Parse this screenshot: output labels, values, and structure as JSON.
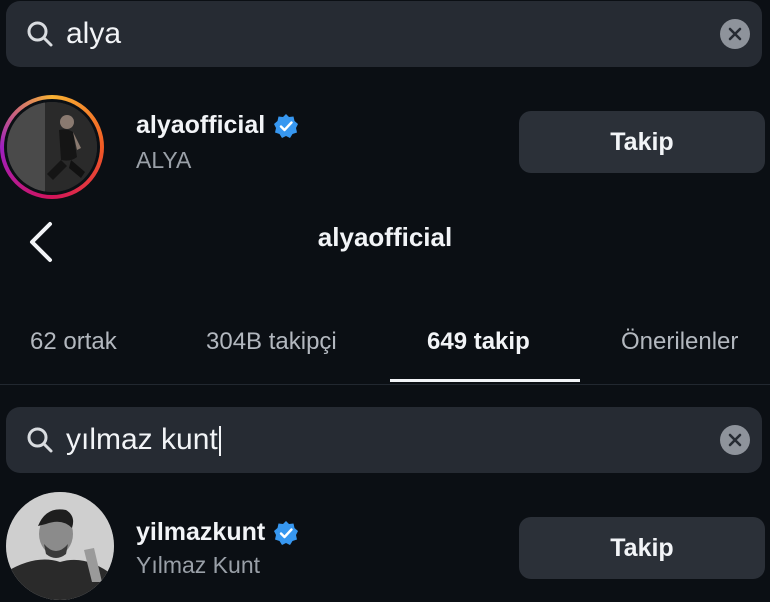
{
  "top_search": {
    "query": "alya"
  },
  "top_result": {
    "username": "alyaofficial",
    "full_name": "ALYA",
    "button_label": "Takip"
  },
  "profile": {
    "title": "alyaofficial",
    "tabs": [
      {
        "label": "62 ortak"
      },
      {
        "label": "304B takipçi"
      },
      {
        "label": "649 takip"
      },
      {
        "label": "Önerilenler"
      }
    ]
  },
  "following_search": {
    "query": "yılmaz kunt"
  },
  "following_result": {
    "username": "yilmazkunt",
    "full_name": "Yılmaz Kunt",
    "button_label": "Takip"
  },
  "colors": {
    "verified": "#3797f0",
    "background": "#0b0f14",
    "field": "#262b33"
  },
  "icons": [
    "search-icon",
    "clear-icon",
    "verified-badge-icon",
    "back-chevron-icon"
  ]
}
